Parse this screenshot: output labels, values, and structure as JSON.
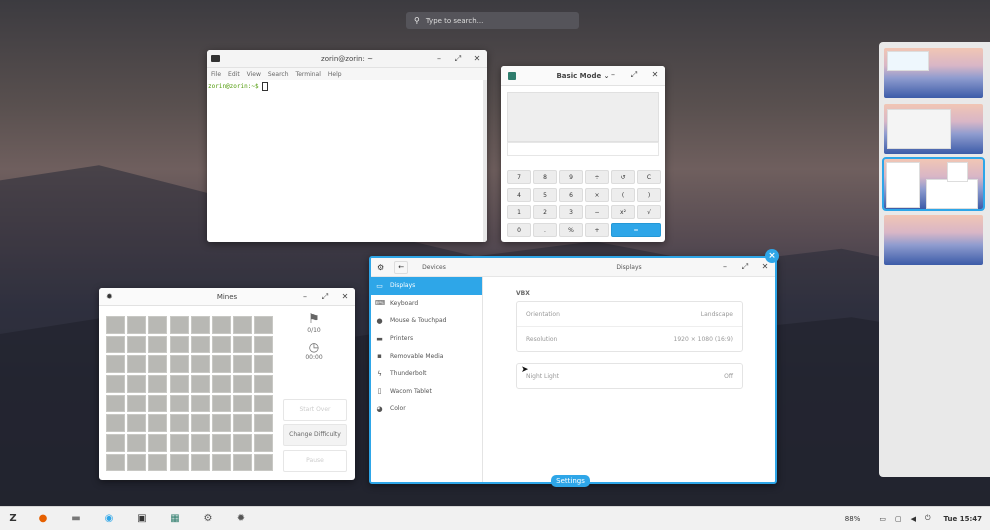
{
  "search": {
    "placeholder": "Type to search..."
  },
  "terminal": {
    "title": "zorin@zorin: ~",
    "menu": [
      "File",
      "Edit",
      "View",
      "Search",
      "Terminal",
      "Help"
    ],
    "prompt": "zorin@zorin:~$"
  },
  "calculator": {
    "title": "Basic Mode",
    "keys": [
      "7",
      "8",
      "9",
      "÷",
      "↺",
      "C",
      "4",
      "5",
      "6",
      "×",
      "(",
      ")",
      "1",
      "2",
      "3",
      "−",
      "x²",
      "√",
      "0",
      ".",
      "%",
      "+",
      "="
    ]
  },
  "mines": {
    "title": "Mines",
    "flags": "0/10",
    "time": "00:00",
    "start_over": "Start Over",
    "change_difficulty": "Change Difficulty",
    "pause": "Pause",
    "rows": 8,
    "cols": 8
  },
  "settings": {
    "section": "Devices",
    "page_title": "Displays",
    "items": [
      {
        "label": "Displays",
        "icon": "display-icon"
      },
      {
        "label": "Keyboard",
        "icon": "keyboard-icon"
      },
      {
        "label": "Mouse & Touchpad",
        "icon": "mouse-icon"
      },
      {
        "label": "Printers",
        "icon": "printer-icon"
      },
      {
        "label": "Removable Media",
        "icon": "removable-media-icon"
      },
      {
        "label": "Thunderbolt",
        "icon": "thunderbolt-icon"
      },
      {
        "label": "Wacom Tablet",
        "icon": "tablet-icon"
      },
      {
        "label": "Color",
        "icon": "color-icon"
      }
    ],
    "monitor": "VBX",
    "orientation_label": "Orientation",
    "orientation_value": "Landscape",
    "resolution_label": "Resolution",
    "resolution_value": "1920 × 1080 (16:9)",
    "night_light_label": "Night Light",
    "night_light_value": "Off",
    "window_label": "Settings"
  },
  "workspaces": {
    "count": 4,
    "active_index": 2
  },
  "taskbar": {
    "apps": [
      "zorin-menu-icon",
      "firefox-icon",
      "files-icon",
      "software-icon",
      "terminal-icon",
      "calculator-icon",
      "settings-icon",
      "mines-icon"
    ],
    "battery": "88%",
    "clock": "Tue 15:47"
  },
  "colors": {
    "accent": "#2ea6e8"
  }
}
